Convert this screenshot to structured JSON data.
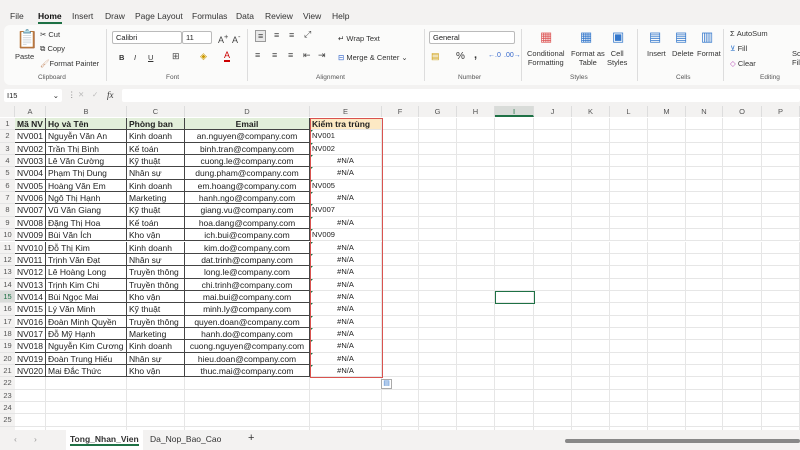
{
  "menu": [
    "File",
    "Home",
    "Insert",
    "Draw",
    "Page Layout",
    "Formulas",
    "Data",
    "Review",
    "View",
    "Help"
  ],
  "menu_active": "Home",
  "ribbon": {
    "paste": "Paste",
    "cut": "Cut",
    "copy": "Copy",
    "format_painter": "Format Painter",
    "clipboard": "Clipboard",
    "font_name": "Calibri",
    "font_size": "11",
    "font": "Font",
    "bold": "B",
    "italic": "I",
    "underline": "U",
    "wrap_text": "Wrap Text",
    "merge_center": "Merge & Center",
    "alignment": "Alignment",
    "number_format": "General",
    "percent": "%",
    "comma": ",",
    "number": "Number",
    "conditional": "Conditional",
    "formatting": "Formatting",
    "format_as": "Format as",
    "table": "Table",
    "cell": "Cell",
    "styles_btn": "Styles",
    "styles": "Styles",
    "insert": "Insert",
    "delete": "Delete",
    "format": "Format",
    "cells": "Cells",
    "autosum": "AutoSum",
    "fill": "Fill",
    "clear": "Clear",
    "editing": "Editing",
    "sort": "So",
    "sort2": "Fil"
  },
  "formula_bar": {
    "name_box": "I15",
    "fx": "fx",
    "value": ""
  },
  "columns": [
    "A",
    "B",
    "C",
    "D",
    "E",
    "F",
    "G",
    "H",
    "I",
    "J",
    "K",
    "L",
    "M",
    "N",
    "O",
    "P"
  ],
  "selected_col": "I",
  "headers": [
    "Mã NV",
    "Họ và Tên",
    "Phòng ban",
    "Email",
    "Kiểm tra trùng"
  ],
  "rows": [
    [
      "NV001",
      "Nguyễn Văn An",
      "Kinh doanh",
      "an.nguyen@company.com",
      "NV001"
    ],
    [
      "NV002",
      "Trần Thị Bình",
      "Kế toán",
      "binh.tran@company.com",
      "NV002"
    ],
    [
      "NV003",
      "Lê Văn Cường",
      "Kỹ thuật",
      "cuong.le@company.com",
      "#N/A"
    ],
    [
      "NV004",
      "Phạm Thị Dung",
      "Nhân sự",
      "dung.pham@company.com",
      "#N/A"
    ],
    [
      "NV005",
      "Hoàng Văn Em",
      "Kinh doanh",
      "em.hoang@company.com",
      "NV005"
    ],
    [
      "NV006",
      "Ngô Thị Hạnh",
      "Marketing",
      "hanh.ngo@company.com",
      "#N/A"
    ],
    [
      "NV007",
      "Vũ Văn Giang",
      "Kỹ thuật",
      "giang.vu@company.com",
      "NV007"
    ],
    [
      "NV008",
      "Đặng Thị Hoa",
      "Kế toán",
      "hoa.dang@company.com",
      "#N/A"
    ],
    [
      "NV009",
      "Bùi Văn Ích",
      "Kho vận",
      "ich.bui@company.com",
      "NV009"
    ],
    [
      "NV010",
      "Đỗ Thị Kim",
      "Kinh doanh",
      "kim.do@company.com",
      "#N/A"
    ],
    [
      "NV011",
      "Trịnh Văn Đạt",
      "Nhân sự",
      "dat.trinh@company.com",
      "#N/A"
    ],
    [
      "NV012",
      "Lê Hoàng Long",
      "Truyền thông",
      "long.le@company.com",
      "#N/A"
    ],
    [
      "NV013",
      "Trịnh Kim Chi",
      "Truyền thông",
      "chi.trinh@company.com",
      "#N/A"
    ],
    [
      "NV014",
      "Bùi Ngọc Mai",
      "Kho vận",
      "mai.bui@company.com",
      "#N/A"
    ],
    [
      "NV015",
      "Lý Văn Minh",
      "Kỹ thuật",
      "minh.ly@company.com",
      "#N/A"
    ],
    [
      "NV016",
      "Đoàn Minh Quyền",
      "Truyền thông",
      "quyen.doan@company.com",
      "#N/A"
    ],
    [
      "NV017",
      "Đỗ Mỹ Hạnh",
      "Marketing",
      "hanh.do@company.com",
      "#N/A"
    ],
    [
      "NV018",
      "Nguyễn Kim Cương",
      "Kinh doanh",
      "cuong.nguyen@company.com",
      "#N/A"
    ],
    [
      "NV019",
      "Đoàn Trung Hiếu",
      "Nhân sự",
      "hieu.doan@company.com",
      "#N/A"
    ],
    [
      "NV020",
      "Mai Đắc Thức",
      "Kho vận",
      "thuc.mai@company.com",
      "#N/A"
    ]
  ],
  "row_numbers": [
    "1",
    "2",
    "3",
    "4",
    "5",
    "6",
    "7",
    "8",
    "9",
    "10",
    "11",
    "12",
    "13",
    "14",
    "15",
    "16",
    "17",
    "18",
    "19",
    "20",
    "21",
    "22",
    "23",
    "24",
    "25",
    "26"
  ],
  "selected_cell": "I15",
  "sheets": [
    "Tong_Nhan_Vien",
    "Da_Nop_Bao_Cao"
  ],
  "active_sheet": "Tong_Nhan_Vien",
  "add_sheet": "+",
  "colors": {
    "header_fill": "#e2efda",
    "check_header_fill": "#fde9c4",
    "highlight_border": "#d9534f",
    "accent": "#1e7145"
  }
}
